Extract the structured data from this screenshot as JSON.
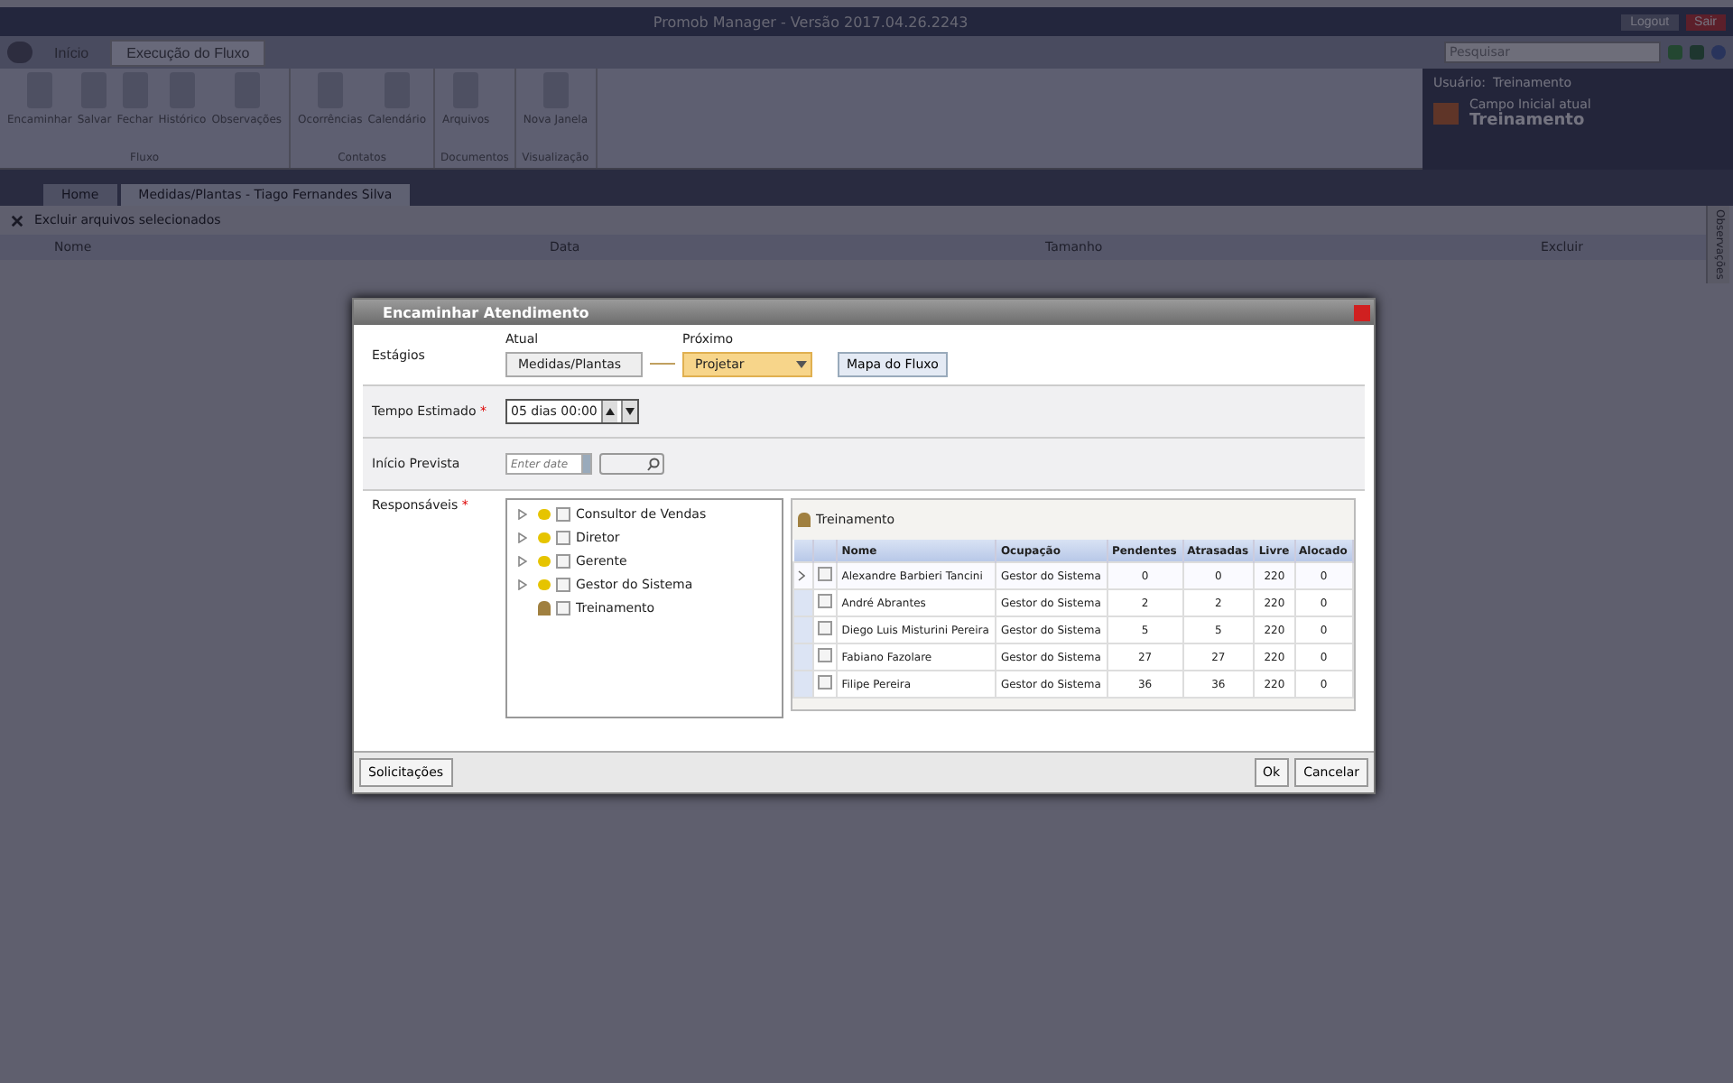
{
  "app": {
    "title": "Promob Manager - Versão 2017.04.26.2243",
    "logout": "Logout",
    "exit": "Sair",
    "search_placeholder": "Pesquisar"
  },
  "ribbon_tabs": [
    {
      "label": "Início",
      "selected": false
    },
    {
      "label": "Execução do Fluxo",
      "selected": true
    }
  ],
  "ribbon_groups": [
    {
      "label": "Fluxo",
      "buttons": [
        "Encaminhar",
        "Salvar",
        "Fechar",
        "Histórico",
        "Observações"
      ]
    },
    {
      "label": "Contatos",
      "buttons": [
        "Ocorrências",
        "Calendário"
      ]
    },
    {
      "label": "Documentos",
      "buttons": [
        "Arquivos"
      ]
    },
    {
      "label": "Visualização",
      "buttons": [
        "Nova Janela"
      ]
    }
  ],
  "user_panel": {
    "user_label": "Usuário:",
    "user": "Treinamento",
    "caption": "Campo Inicial atual",
    "value": "Treinamento"
  },
  "doc_tabs": [
    {
      "label": "Home",
      "selected": false
    },
    {
      "label": "Medidas/Plantas - Tiago Fernandes Silva",
      "selected": true
    }
  ],
  "files_toolbar": {
    "delete_label": "Excluir arquivos selecionados"
  },
  "files_table": {
    "columns": [
      "Nome",
      "Data",
      "Tamanho",
      "Excluir"
    ]
  },
  "side_tab": "Observações",
  "dialog": {
    "title": "Encaminhar Atendimento",
    "stages": {
      "label": "Estágios",
      "current_caption": "Atual",
      "current": "Medidas/Plantas",
      "next_caption": "Próximo",
      "next": "Projetar",
      "map_button": "Mapa do Fluxo"
    },
    "estimated_time": {
      "label": "Tempo Estimado",
      "required_mark": "*",
      "value": "05 dias 00:00"
    },
    "start": {
      "label": "Início Prevista",
      "placeholder": "Enter date"
    },
    "responsible": {
      "label": "Responsáveis",
      "required_mark": "*",
      "tree": [
        {
          "kind": "group",
          "label": "Consultor de Vendas",
          "checked": false
        },
        {
          "kind": "group",
          "label": "Diretor",
          "checked": false
        },
        {
          "kind": "group",
          "label": "Gerente",
          "checked": false
        },
        {
          "kind": "group",
          "label": "Gestor do Sistema",
          "checked": false
        },
        {
          "kind": "user",
          "label": "Treinamento",
          "checked": false
        }
      ],
      "panel_title": "Treinamento",
      "columns": [
        "Nome",
        "Ocupação",
        "Pendentes",
        "Atrasadas",
        "Livre",
        "Alocado"
      ],
      "rows": [
        {
          "selected": true,
          "checked": false,
          "cells": [
            "Alexandre Barbieri Tancini",
            "Gestor do Sistema",
            "0",
            "0",
            "220",
            "0"
          ]
        },
        {
          "selected": false,
          "checked": false,
          "cells": [
            "André Abrantes",
            "Gestor do Sistema",
            "2",
            "2",
            "220",
            "0"
          ]
        },
        {
          "selected": false,
          "checked": false,
          "cells": [
            "Diego Luis Misturini Pereira",
            "Gestor do Sistema",
            "5",
            "5",
            "220",
            "0"
          ]
        },
        {
          "selected": false,
          "checked": false,
          "cells": [
            "Fabiano Fazolare",
            "Gestor do Sistema",
            "27",
            "27",
            "220",
            "0"
          ]
        },
        {
          "selected": false,
          "checked": false,
          "cells": [
            "Filipe Pereira",
            "Gestor do Sistema",
            "36",
            "36",
            "220",
            "0"
          ]
        }
      ]
    },
    "buttons": {
      "left": "Solicitações",
      "ok": "Ok",
      "cancel": "Cancelar"
    }
  }
}
